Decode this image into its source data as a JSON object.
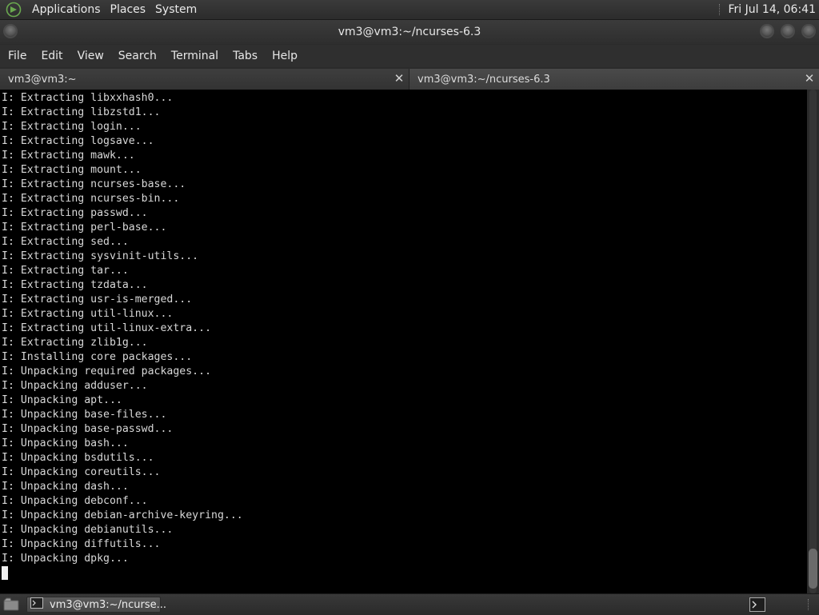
{
  "top_panel": {
    "menus": [
      "Applications",
      "Places",
      "System"
    ],
    "clock": "Fri Jul 14, 06:41"
  },
  "window": {
    "title": "vm3@vm3:~/ncurses-6.3"
  },
  "menubar": {
    "items": [
      "File",
      "Edit",
      "View",
      "Search",
      "Terminal",
      "Tabs",
      "Help"
    ]
  },
  "tabs": [
    {
      "label": "vm3@vm3:~",
      "active": false
    },
    {
      "label": "vm3@vm3:~/ncurses-6.3",
      "active": true
    }
  ],
  "terminal": {
    "lines": [
      "I: Extracting libxxhash0...",
      "I: Extracting libzstd1...",
      "I: Extracting login...",
      "I: Extracting logsave...",
      "I: Extracting mawk...",
      "I: Extracting mount...",
      "I: Extracting ncurses-base...",
      "I: Extracting ncurses-bin...",
      "I: Extracting passwd...",
      "I: Extracting perl-base...",
      "I: Extracting sed...",
      "I: Extracting sysvinit-utils...",
      "I: Extracting tar...",
      "I: Extracting tzdata...",
      "I: Extracting usr-is-merged...",
      "I: Extracting util-linux...",
      "I: Extracting util-linux-extra...",
      "I: Extracting zlib1g...",
      "I: Installing core packages...",
      "I: Unpacking required packages...",
      "I: Unpacking adduser...",
      "I: Unpacking apt...",
      "I: Unpacking base-files...",
      "I: Unpacking base-passwd...",
      "I: Unpacking bash...",
      "I: Unpacking bsdutils...",
      "I: Unpacking coreutils...",
      "I: Unpacking dash...",
      "I: Unpacking debconf...",
      "I: Unpacking debian-archive-keyring...",
      "I: Unpacking debianutils...",
      "I: Unpacking diffutils...",
      "I: Unpacking dpkg..."
    ]
  },
  "taskbar": {
    "window_button": "vm3@vm3:~/ncurse..."
  },
  "colors": {
    "terminal_bg": "#000000",
    "terminal_fg": "#d8d8d8",
    "panel_bg": "#333333"
  }
}
